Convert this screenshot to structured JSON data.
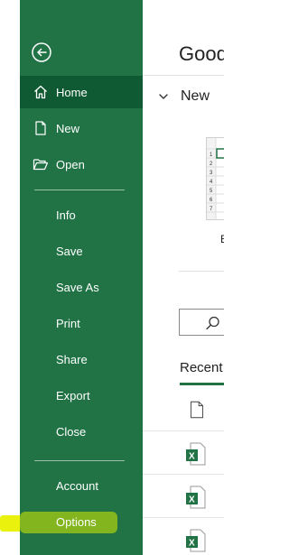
{
  "backstage": {
    "back_icon": "back-arrow-circle-icon",
    "items": [
      {
        "label": "Home",
        "icon": "home-icon",
        "active": true
      },
      {
        "label": "New",
        "icon": "new-document-icon",
        "active": false
      },
      {
        "label": "Open",
        "icon": "open-folder-icon",
        "active": false
      },
      {
        "label": "Info"
      },
      {
        "label": "Save"
      },
      {
        "label": "Save As"
      },
      {
        "label": "Print"
      },
      {
        "label": "Share"
      },
      {
        "label": "Export"
      },
      {
        "label": "Close"
      },
      {
        "label": "Account"
      },
      {
        "label": "Options"
      }
    ],
    "accent_color": "#217346"
  },
  "content": {
    "greeting": "Good",
    "new_section_label": "New",
    "template_label_fragment": "E",
    "recent_title": "Recent"
  },
  "annotation": {
    "highlight_color": "#e8f000"
  }
}
